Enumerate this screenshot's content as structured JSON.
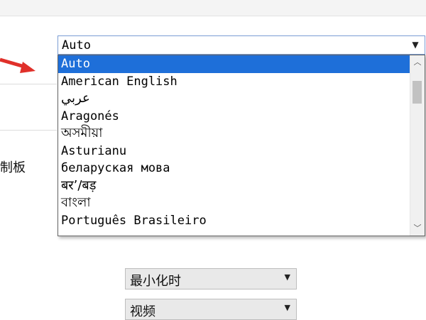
{
  "side_label": "制板",
  "language_combo": {
    "value": "Auto",
    "arrow_icon": "chevron-down-icon"
  },
  "language_options": [
    {
      "label": "Auto",
      "selected": true
    },
    {
      "label": "American English",
      "selected": false
    },
    {
      "label": "عربي",
      "selected": false
    },
    {
      "label": "Aragonés",
      "selected": false
    },
    {
      "label": "অসমীয়া",
      "selected": false
    },
    {
      "label": "Asturianu",
      "selected": false
    },
    {
      "label": "беларуская мова",
      "selected": false
    },
    {
      "label": "बर’/बड़",
      "selected": false
    },
    {
      "label": "বাংলা",
      "selected": false
    },
    {
      "label": "Português Brasileiro",
      "selected": false
    }
  ],
  "minimize_select": {
    "value": "最小化时"
  },
  "video_select": {
    "value": "视频"
  },
  "colors": {
    "selection": "#1e6fd9",
    "arrow": "#e0302a",
    "combo_border": "#7a9cd3"
  }
}
